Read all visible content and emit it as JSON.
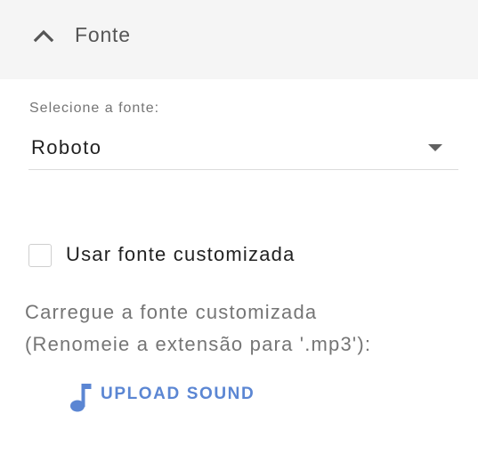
{
  "section": {
    "title": "Fonte",
    "collapse_icon": "chevron-up-icon"
  },
  "font_select": {
    "label": "Selecione a fonte:",
    "value": "Roboto",
    "arrow_icon": "dropdown-arrow-icon"
  },
  "custom_font": {
    "checkbox_label": "Usar fonte customizada",
    "checked": false
  },
  "upload": {
    "info_line1": "Carregue a fonte customizada",
    "info_line2": "(Renomeie a extensão para '.mp3'):",
    "button_label": "UPLOAD SOUND",
    "button_icon": "music-note-icon"
  },
  "colors": {
    "header_bg": "#f5f5f5",
    "accent": "#5b86d3",
    "text_primary": "#222222",
    "text_secondary": "#757575"
  }
}
